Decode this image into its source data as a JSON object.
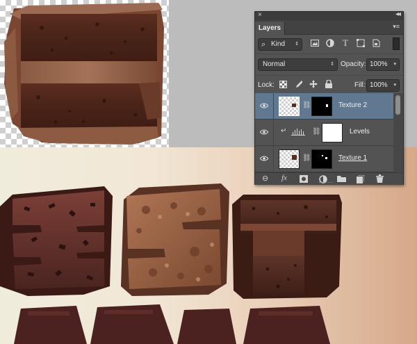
{
  "panel": {
    "close_glyph": "×",
    "collapse_glyph": "◂◂",
    "menu_glyph": "▾≡",
    "tab_label": "Layers",
    "filter": {
      "search_glyph": "⌕",
      "value": "Kind",
      "arrow": "⇕"
    },
    "blend_mode": {
      "value": "Normal",
      "arrow": "⇕"
    },
    "opacity": {
      "label": "Opacity:",
      "value": "100%",
      "arrow": "▾"
    },
    "lock": {
      "label": "Lock:"
    },
    "fill": {
      "label": "Fill:",
      "value": "100%",
      "arrow": "▾"
    },
    "filter_icons": [
      "image-filter-icon",
      "adjustment-filter-icon",
      "type-filter-icon",
      "shape-filter-icon",
      "smart-object-filter-icon"
    ],
    "lock_icons": [
      "lock-transparent-icon",
      "lock-image-icon",
      "lock-position-icon",
      "lock-all-icon"
    ],
    "layers": [
      {
        "name": "Texture 2",
        "selected": true,
        "type": "texture"
      },
      {
        "name": "Levels",
        "selected": false,
        "type": "adjustment",
        "clipped": true
      },
      {
        "name": "Texture 1",
        "selected": false,
        "type": "texture"
      }
    ],
    "footer_icons": [
      "link-layers-icon",
      "fx-icon",
      "add-mask-icon",
      "new-adjustment-icon",
      "new-group-icon",
      "new-layer-icon",
      "trash-icon"
    ],
    "colors": {
      "panel": "#535353",
      "selected": "#607990"
    }
  }
}
